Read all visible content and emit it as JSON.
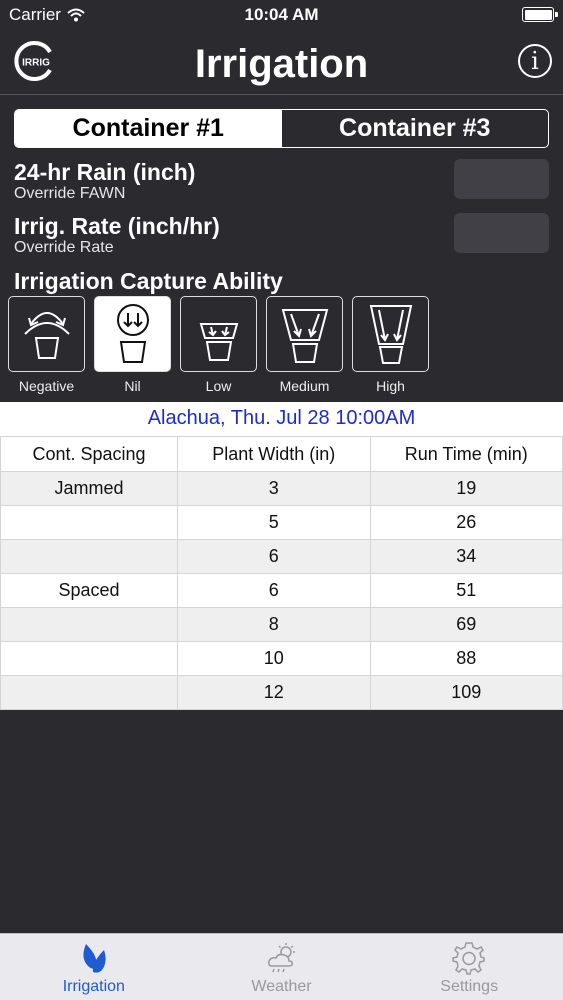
{
  "status": {
    "carrier": "Carrier",
    "time": "10:04 AM"
  },
  "nav": {
    "logo_text": "IRRIG",
    "title": "Irrigation",
    "info_symbol": "i"
  },
  "segments": [
    {
      "label": "Container #1",
      "active": true
    },
    {
      "label": "Container #3",
      "active": false
    }
  ],
  "rain": {
    "label": "24-hr Rain (inch)",
    "sub": "Override FAWN",
    "value": ""
  },
  "rate": {
    "label": "Irrig. Rate (inch/hr)",
    "sub": "Override Rate",
    "value": ""
  },
  "capture": {
    "title": "Irrigation Capture Ability",
    "options": [
      "Negative",
      "Nil",
      "Low",
      "Medium",
      "High"
    ],
    "selected": "Nil"
  },
  "location": "Alachua, Thu. Jul 28 10:00AM",
  "table": {
    "headers": [
      "Cont. Spacing",
      "Plant Width (in)",
      "Run Time (min)"
    ],
    "rows": [
      [
        "Jammed",
        "3",
        "19"
      ],
      [
        "",
        "5",
        "26"
      ],
      [
        "",
        "6",
        "34"
      ],
      [
        "Spaced",
        "6",
        "51"
      ],
      [
        "",
        "8",
        "69"
      ],
      [
        "",
        "10",
        "88"
      ],
      [
        "",
        "12",
        "109"
      ]
    ]
  },
  "tabs": [
    {
      "label": "Irrigation",
      "icon": "leaf-icon",
      "active": true
    },
    {
      "label": "Weather",
      "icon": "weather-icon",
      "active": false
    },
    {
      "label": "Settings",
      "icon": "gear-icon",
      "active": false
    }
  ],
  "colors": {
    "accent": "#1f5ccf",
    "location": "#1d2cd0",
    "background": "#2b2a2f"
  }
}
